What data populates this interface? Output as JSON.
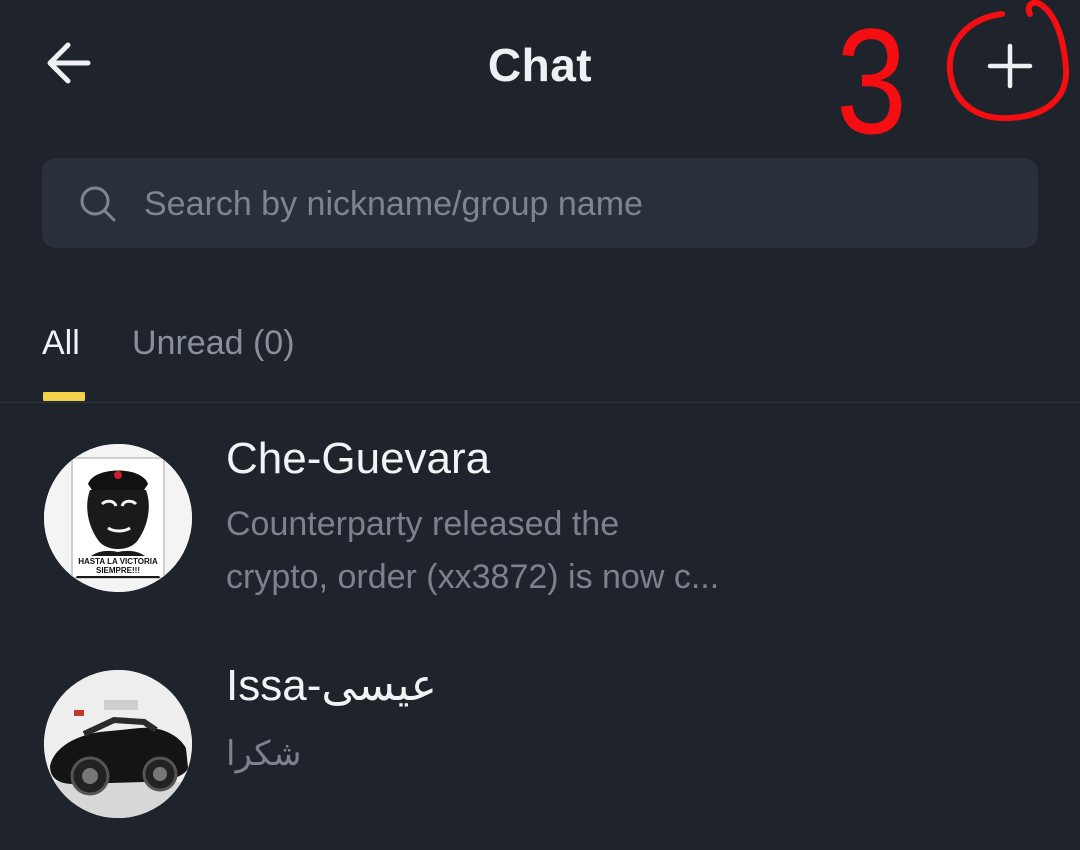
{
  "header": {
    "title": "Chat",
    "back_icon": "arrow-left-icon",
    "add_icon": "plus-icon"
  },
  "annotation": {
    "number": "3",
    "color": "#f40e12"
  },
  "search": {
    "placeholder": "Search by nickname/group name",
    "icon": "search-icon"
  },
  "tabs": [
    {
      "label": "All",
      "active": true
    },
    {
      "label": "Unread (0)",
      "active": false
    }
  ],
  "chats": [
    {
      "name": "Che-Guevara",
      "preview_line1": "Counterparty released the",
      "preview_line2": "crypto, order (xx3872) is now c...",
      "avatar_caption_line1": "HASTA LA VICTORIA",
      "avatar_caption_line2": "SIEMPRE!!!"
    },
    {
      "name": "Issa-عیسی",
      "preview_line1": "شکرا"
    }
  ],
  "colors": {
    "background": "#1f232b",
    "search_bg": "#2a303b",
    "accent": "#f3d24a",
    "text_primary": "#f2f3f5",
    "text_secondary": "#7c828d"
  }
}
